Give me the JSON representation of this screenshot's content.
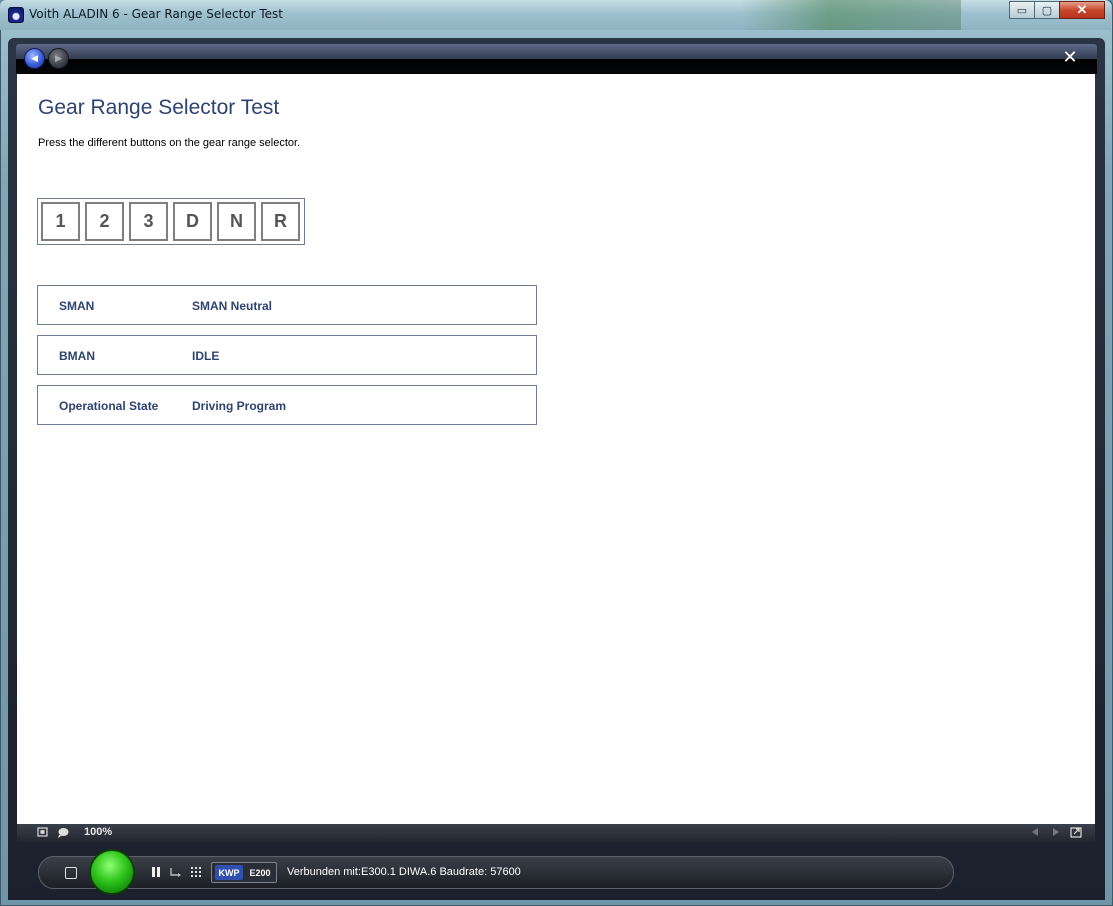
{
  "window": {
    "title": "Voith ALADIN 6 - Gear Range Selector Test",
    "controls": {
      "minimize": "▭",
      "maximize": "▢",
      "close": "✕"
    }
  },
  "nav": {
    "back_icon": "◀",
    "forward_icon": "▶",
    "close_icon": "✕"
  },
  "page": {
    "title": "Gear Range Selector Test",
    "instruction": "Press the different buttons on the gear range selector."
  },
  "gear_selector": {
    "keys": [
      "1",
      "2",
      "3",
      "D",
      "N",
      "R"
    ]
  },
  "status_rows": [
    {
      "label": "SMAN",
      "value": "SMAN Neutral"
    },
    {
      "label": "BMAN",
      "value": "IDLE"
    },
    {
      "label": "Operational State",
      "value": "Driving Program"
    }
  ],
  "footer": {
    "zoom": "100%",
    "icons": [
      "fit-screen-icon",
      "comment-icon",
      "prev-page-icon",
      "next-page-icon",
      "external-link-icon"
    ]
  },
  "statusbar": {
    "protocol": "KWP",
    "ecu": "E200",
    "connection": "Verbunden mit:E300.1  DIWA.6 Baudrate: 57600"
  },
  "colors": {
    "title": "#2e4370",
    "border": "#6e7c96",
    "go_button": "#2fc41c",
    "kwp_badge": "#3050b0"
  }
}
